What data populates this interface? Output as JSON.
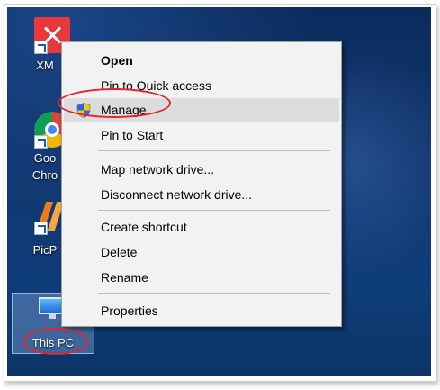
{
  "desktop": {
    "icons": [
      {
        "label": "XM",
        "icon": "xm-app-icon"
      },
      {
        "label": "Goo",
        "label2": "Chro",
        "icon": "chrome-icon"
      },
      {
        "label": "PicP",
        "icon": "picpick-icon"
      },
      {
        "label": "This PC",
        "icon": "computer-icon"
      }
    ]
  },
  "context_menu": {
    "items": [
      {
        "label": "Open",
        "bold": true
      },
      {
        "label": "Pin to Quick access"
      },
      {
        "label": "Manage",
        "icon": "uac-shield-icon",
        "highlighted": true
      },
      {
        "label": "Pin to Start"
      },
      {
        "label": "Map network drive..."
      },
      {
        "label": "Disconnect network drive..."
      },
      {
        "label": "Create shortcut"
      },
      {
        "label": "Delete"
      },
      {
        "label": "Rename"
      },
      {
        "label": "Properties"
      }
    ]
  },
  "colors": {
    "annotation": "#e2252b",
    "menu_background": "#f2f2f2",
    "menu_highlight": "#dcdcdc"
  }
}
